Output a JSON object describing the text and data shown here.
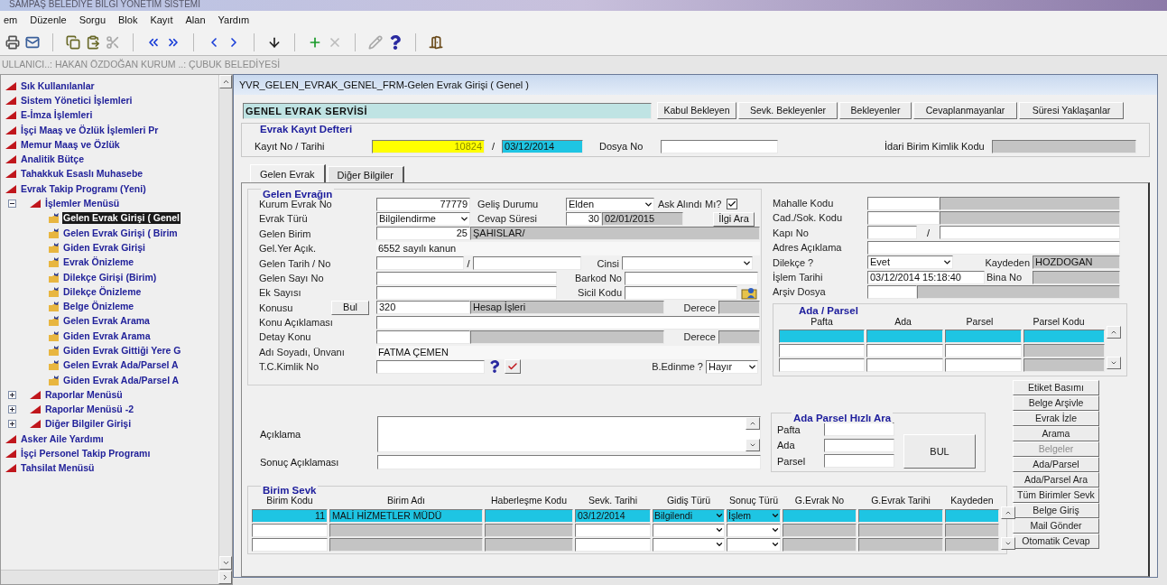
{
  "app_title": "SAMPAŞ BELEDİYE BİLGİ YÖNETİM SİSTEMİ",
  "menu": [
    "em",
    "Düzenle",
    "Sorgu",
    "Blok",
    "Kayıt",
    "Alan",
    "Yardım"
  ],
  "user_bar": "ULLANICI..: HAKAN ÖZDOĞAN KURUM ..: ÇUBUK BELEDİYESİ",
  "sidebar": {
    "items": [
      {
        "label": "Sık Kullanılanlar"
      },
      {
        "label": "Sistem Yönetici İşlemleri"
      },
      {
        "label": "E-İmza İşlemleri"
      },
      {
        "label": "İşçi Maaş ve Özlük İşlemleri Pr"
      },
      {
        "label": "Memur Maaş ve Özlük"
      },
      {
        "label": "Analitik Bütçe"
      },
      {
        "label": "Tahakkuk Esaslı Muhasebe"
      },
      {
        "label": "Evrak Takip Programı (Yeni)",
        "children": [
          {
            "label": "İşlemler Menüsü",
            "expanded": true,
            "children": [
              {
                "label": "Gelen Evrak Girişi ( Genel",
                "selected": true
              },
              {
                "label": "Gelen Evrak Girişi ( Birim",
                "selected": false
              },
              {
                "label": "Giden Evrak Girişi",
                "selected": false
              },
              {
                "label": "Evrak Önizleme",
                "selected": false
              },
              {
                "label": "Dilekçe Girişi (Birim)",
                "selected": false
              },
              {
                "label": "Dilekçe Önizleme",
                "selected": false
              },
              {
                "label": "Belge Önizleme",
                "selected": false
              },
              {
                "label": "Gelen Evrak Arama",
                "selected": false
              },
              {
                "label": "Giden Evrak Arama",
                "selected": false
              },
              {
                "label": "Giden Evrak Gittiği Yere G",
                "selected": false
              },
              {
                "label": "Gelen Evrak Ada/Parsel A",
                "selected": false
              },
              {
                "label": "Giden Evrak Ada/Parsel A",
                "selected": false
              }
            ]
          },
          {
            "label": "Raporlar Menüsü",
            "expanded": false
          },
          {
            "label": "Raporlar Menüsü -2",
            "expanded": false
          },
          {
            "label": "Diğer Bilgiler Girişi",
            "expanded": false
          }
        ]
      },
      {
        "label": "Asker Aile Yardımı"
      },
      {
        "label": "İşçi Personel Takip Programı"
      },
      {
        "label": "Tahsilat Menüsü"
      }
    ]
  },
  "window": {
    "title": "YVR_GELEN_EVRAK_GENEL_FRM-Gelen Evrak Girişi ( Genel )",
    "service": "GENEL EVRAK SERVİSİ",
    "filter_buttons": [
      "Kabul Bekleyen",
      "Sevk. Bekleyenler",
      "Bekleyenler",
      "Cevaplanmayanlar",
      "Süresi Yaklaşanlar"
    ],
    "register": {
      "title": "Evrak Kayıt Defteri",
      "label": "Kayıt No / Tarihi",
      "kayit_no": {
        "value": "10824",
        "kind": "required"
      },
      "separator": "/",
      "tarih": {
        "value": "03/12/2014",
        "kind": "active"
      },
      "dosya_label": "Dosya No",
      "idari_label": "İdari Birim Kimlik Kodu"
    },
    "tabs": [
      {
        "label": "Gelen Evrak",
        "selected": true
      },
      {
        "label": "Diğer Bilgiler",
        "selected": false
      }
    ],
    "form": {
      "title": "Gelen Evrağın",
      "left_rows": [
        {
          "items": [
            {
              "kind": "label",
              "text": "Kurum Evrak No"
            },
            {
              "kind": "number",
              "text": "77779"
            },
            {
              "kind": "label",
              "text": "Geliş Durumu"
            },
            {
              "kind": "combo",
              "text": "Elden"
            },
            {
              "kind": "label",
              "text": "Ask Alındı Mı?"
            },
            {
              "kind": "check",
              "checked": true
            }
          ]
        },
        {
          "items": [
            {
              "kind": "label",
              "text": "Evrak Türü"
            },
            {
              "kind": "combo",
              "text": "Bilgilendirme"
            },
            {
              "kind": "label",
              "text": "Cevap Süresi"
            },
            {
              "kind": "number",
              "text": "30"
            },
            {
              "kind": "readonly",
              "text": "02/01/2015"
            },
            {
              "kind": "button",
              "text": "İlgi Ara"
            }
          ]
        },
        {
          "items": [
            {
              "kind": "label",
              "text": "Gelen Birim"
            },
            {
              "kind": "number",
              "text": "25"
            },
            {
              "kind": "readonly",
              "text": "ŞAHISLAR/"
            }
          ]
        },
        {
          "items": [
            {
              "kind": "label",
              "text": "Gel.Yer Açık."
            },
            {
              "kind": "plain",
              "text": "6552 sayılı kanun"
            }
          ]
        },
        {
          "items": [
            {
              "kind": "label",
              "text": "Gelen Tarih / No"
            },
            {
              "kind": "field"
            },
            {
              "kind": "sep",
              "text": "/"
            },
            {
              "kind": "field"
            },
            {
              "kind": "label",
              "text": "Cinsi"
            },
            {
              "kind": "combo"
            }
          ]
        },
        {
          "items": [
            {
              "kind": "label",
              "text": "Gelen Sayı No"
            },
            {
              "kind": "field"
            },
            {
              "kind": "label",
              "text": "Barkod No"
            },
            {
              "kind": "field"
            }
          ]
        },
        {
          "items": [
            {
              "kind": "label",
              "text": "Ek Sayısı"
            },
            {
              "kind": "field"
            },
            {
              "kind": "label",
              "text": "Sicil Kodu"
            },
            {
              "kind": "field"
            }
          ]
        },
        {
          "items": [
            {
              "kind": "label",
              "text": "Konusu"
            },
            {
              "kind": "button",
              "text": "Bul"
            },
            {
              "kind": "field",
              "text": "320"
            },
            {
              "kind": "readonly",
              "text": "Hesap İşleri"
            },
            {
              "kind": "label",
              "text": "Derece"
            },
            {
              "kind": "readonly"
            }
          ]
        },
        {
          "items": [
            {
              "kind": "label",
              "text": "Konu Açıklaması"
            },
            {
              "kind": "field"
            }
          ]
        },
        {
          "items": [
            {
              "kind": "label",
              "text": "Detay Konu"
            },
            {
              "kind": "field"
            },
            {
              "kind": "readonly"
            },
            {
              "kind": "label",
              "text": "Derece"
            },
            {
              "kind": "readonly"
            }
          ]
        },
        {
          "items": [
            {
              "kind": "label",
              "text": "Adı Soyadı, Ünvanı"
            },
            {
              "kind": "plain",
              "text": "FATMA ÇEMEN"
            }
          ]
        },
        {
          "items": [
            {
              "kind": "label",
              "text": "T.C.Kimlik No"
            },
            {
              "kind": "field"
            },
            {
              "kind": "label",
              "text": "B.Edinme ?"
            },
            {
              "kind": "combo",
              "text": "Hayır"
            }
          ]
        }
      ],
      "right_rows": [
        {
          "items": [
            {
              "kind": "label",
              "text": "Mahalle Kodu"
            },
            {
              "kind": "field"
            },
            {
              "kind": "readonly"
            }
          ]
        },
        {
          "items": [
            {
              "kind": "label",
              "text": "Cad./Sok. Kodu"
            },
            {
              "kind": "field"
            },
            {
              "kind": "readonly"
            }
          ]
        },
        {
          "items": [
            {
              "kind": "label",
              "text": "Kapı No"
            },
            {
              "kind": "field"
            },
            {
              "kind": "sep",
              "text": "/"
            },
            {
              "kind": "field"
            }
          ]
        },
        {
          "items": [
            {
              "kind": "label",
              "text": "Adres Açıklama"
            },
            {
              "kind": "field"
            }
          ]
        },
        {
          "items": [
            {
              "kind": "label",
              "text": "Dilekçe ?"
            },
            {
              "kind": "combo",
              "text": "Evet"
            },
            {
              "kind": "label",
              "text": "Kaydeden"
            },
            {
              "kind": "readonly",
              "text": "HOZDOGAN"
            }
          ]
        },
        {
          "items": [
            {
              "kind": "label",
              "text": "İşlem Tarihi"
            },
            {
              "kind": "field",
              "text": "03/12/2014 15:18:40"
            },
            {
              "kind": "label",
              "text": "Bina No"
            },
            {
              "kind": "readonly"
            }
          ]
        },
        {
          "items": [
            {
              "kind": "label",
              "text": "Arşiv Dosya"
            },
            {
              "kind": "field"
            },
            {
              "kind": "readonly"
            }
          ]
        }
      ],
      "ada_parsel": {
        "title": "Ada / Parsel",
        "columns": [
          {
            "label": "Pafta",
            "kind": "field"
          },
          {
            "label": "Ada",
            "kind": "field"
          },
          {
            "label": "Parsel",
            "kind": "field"
          },
          {
            "label": "Parsel Kodu",
            "kind": "readonly"
          }
        ],
        "rows": [
          {
            "selected": true
          },
          {
            "selected": false
          },
          {
            "selected": false
          }
        ]
      },
      "aciklama": "Açıklama",
      "sonuc": "Sonuç Açıklaması",
      "hizli_ara": {
        "title": "Ada Parsel Hızlı Ara",
        "fields": [
          "Pafta",
          "Ada",
          "Parsel"
        ],
        "button": "BUL"
      },
      "birim_sevk": {
        "title": "Birim Sevk",
        "columns": [
          {
            "label": "Birim Kodu",
            "kind": "number"
          },
          {
            "label": "Birim Adı",
            "kind": "readonly"
          },
          {
            "label": "Haberleşme Kodu",
            "kind": "readonly"
          },
          {
            "label": "Sevk. Tarihi",
            "kind": "field"
          },
          {
            "label": "Gidiş Türü",
            "kind": "combo"
          },
          {
            "label": "Sonuç Türü",
            "kind": "combo"
          },
          {
            "label": "G.Evrak No",
            "kind": "readonly"
          },
          {
            "label": "G.Evrak Tarihi",
            "kind": "readonly"
          },
          {
            "label": "Kaydeden",
            "kind": "readonly"
          }
        ],
        "rows": [
          {
            "selected": true,
            "cells": [
              "11",
              "MALİ HİZMETLER MÜDÜ",
              "",
              "03/12/2014",
              "Bilgilendi",
              "İşlem",
              "",
              "",
              ""
            ]
          },
          {
            "selected": false,
            "cells": [
              "",
              "",
              "",
              "",
              "",
              "",
              "",
              "",
              ""
            ]
          },
          {
            "selected": false,
            "cells": [
              "",
              "",
              "",
              "",
              "",
              "",
              "",
              "",
              ""
            ]
          }
        ]
      },
      "side_buttons": [
        {
          "label": "Etiket Basımı",
          "disabled": false
        },
        {
          "label": "Belge Arşivle",
          "disabled": false
        },
        {
          "label": "Evrak İzle",
          "disabled": false
        },
        {
          "label": "Arama",
          "disabled": false
        },
        {
          "label": "Belgeler",
          "disabled": true
        },
        {
          "label": "Ada/Parsel",
          "disabled": false
        },
        {
          "label": "Ada/Parsel Ara",
          "disabled": false
        },
        {
          "label": "Tüm Birimler Sevk",
          "disabled": false
        },
        {
          "label": "Belge Giriş",
          "disabled": false
        },
        {
          "label": "Mail Gönder",
          "disabled": false
        },
        {
          "label": "Otomatik Cevap",
          "disabled": false
        }
      ]
    }
  }
}
